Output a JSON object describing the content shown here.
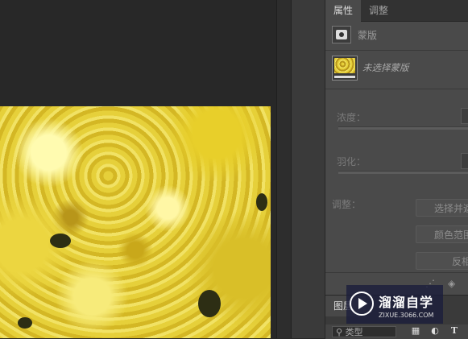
{
  "properties_panel": {
    "tabs": [
      {
        "label": "属性",
        "active": true
      },
      {
        "label": "调整",
        "active": false
      }
    ],
    "mask_label": "蒙版",
    "no_mask_selected": "未选择蒙版",
    "density_label": "浓度：",
    "feather_label": "羽化：",
    "adjust_label": "调整：",
    "buttons": {
      "select_and_mask": "选择并遮",
      "color_range": "颜色范围",
      "invert": "反相"
    },
    "bottom_icons": [
      "dotted-selection-icon",
      "eye-icon"
    ]
  },
  "layers_panel": {
    "title": "图层",
    "filter_kind": "类型",
    "filter_icons": [
      "image-filter-icon",
      "adjustment-filter-icon",
      "type-filter-icon"
    ],
    "type_glyph": "T"
  },
  "watermark": {
    "title": "溜溜自学",
    "url": "ZIXUE.3066.COM"
  },
  "colors": {
    "canvas_bg": "#282828",
    "panel_bg": "#4a4a4a",
    "flower_yellow": "#e6d03a"
  }
}
